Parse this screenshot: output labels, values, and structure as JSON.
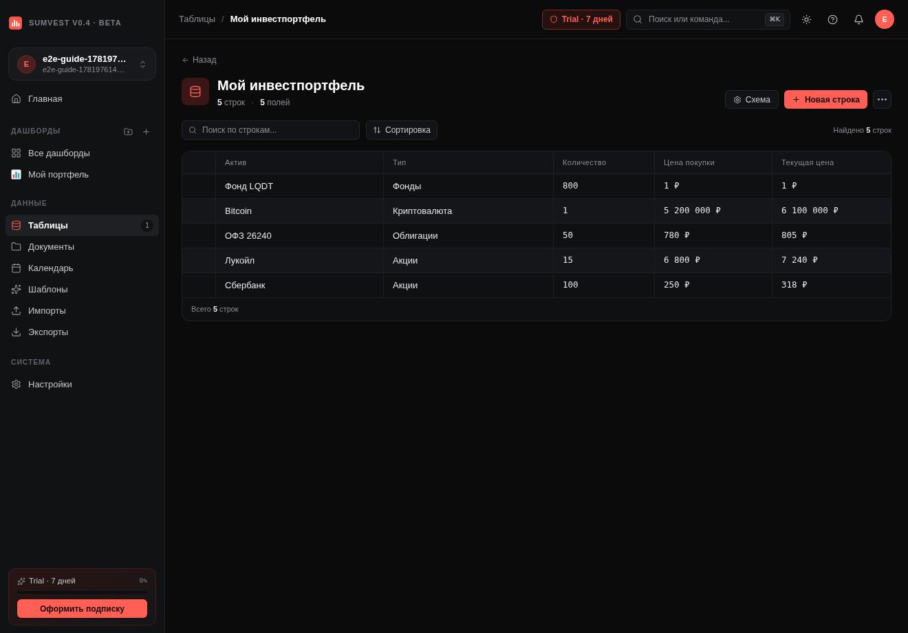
{
  "sidebar": {
    "brand": "SUMVEST V0.4 · BETA",
    "account": {
      "avatar": "E",
      "name": "e2e-guide-178197…",
      "email": "e2e-guide-178197614…"
    },
    "sections": [
      {
        "items": [
          {
            "label": "Главная",
            "selected": false
          }
        ]
      },
      {
        "title": "ДАШБОРДЫ",
        "has_actions": true,
        "items": [
          {
            "label": "Все дашборды",
            "selected": false
          },
          {
            "label": "Мой портфель",
            "selected": false
          }
        ]
      },
      {
        "title": "ДАННЫЕ",
        "has_actions": false,
        "items": [
          {
            "label": "Таблицы",
            "selected": true,
            "badge": "1"
          },
          {
            "label": "Документы",
            "selected": false
          },
          {
            "label": "Календарь",
            "selected": false
          },
          {
            "label": "Шаблоны",
            "selected": false
          },
          {
            "label": "Импорты",
            "selected": false
          },
          {
            "label": "Экспорты",
            "selected": false
          }
        ]
      },
      {
        "title": "СИСТЕМА",
        "has_actions": false,
        "items": [
          {
            "label": "Настройки",
            "selected": false
          }
        ]
      }
    ],
    "trial": {
      "label": "Trial · 7 дней",
      "percent": "0%",
      "level": 0,
      "button": "Оформить подписку"
    }
  },
  "header": {
    "breadcrumbs": [
      {
        "label": "Таблицы",
        "current": false
      },
      {
        "label": "Мой инвестпортфель",
        "current": true
      }
    ],
    "breadcrumb_separator": "/",
    "trial_badge": "Trial · 7 дней",
    "search": {
      "placeholder": "Поиск или команда...",
      "shortcut": "⌘K"
    },
    "avatar": "E"
  },
  "page": {
    "back": "Назад",
    "title": "Мой инвестпортфель",
    "stats": [
      "**5** строк",
      "**5** полей"
    ],
    "stats_separator": "·",
    "actions": {
      "schema": "Схема",
      "new_row": "Новая строка"
    },
    "row_search": {
      "placeholder": "Поиск по строкам..."
    },
    "sort": "Сортировка",
    "found": "Найдено **5** строк",
    "table": {
      "columns": [
        {
          "label": "Актив",
          "kind": "text"
        },
        {
          "label": "Тип",
          "kind": "text"
        },
        {
          "label": "Количество",
          "kind": "number"
        },
        {
          "label": "Цена покупки",
          "kind": "number"
        },
        {
          "label": "Текущая цена",
          "kind": "number"
        }
      ],
      "rows": [
        [
          "Фонд LQDT",
          "Фонды",
          "800",
          "1 ₽",
          "1 ₽"
        ],
        [
          "Bitcoin",
          "Криптовалюта",
          "1",
          "5 200 000 ₽",
          "6 100 000 ₽"
        ],
        [
          "ОФЗ 26240",
          "Облигации",
          "50",
          "780 ₽",
          "805 ₽"
        ],
        [
          "Лукойл",
          "Акции",
          "15",
          "6 800 ₽",
          "7 240 ₽"
        ],
        [
          "Сбербанк",
          "Акции",
          "100",
          "250 ₽",
          "318 ₽"
        ]
      ],
      "footer": "Всего **5** строк"
    }
  }
}
